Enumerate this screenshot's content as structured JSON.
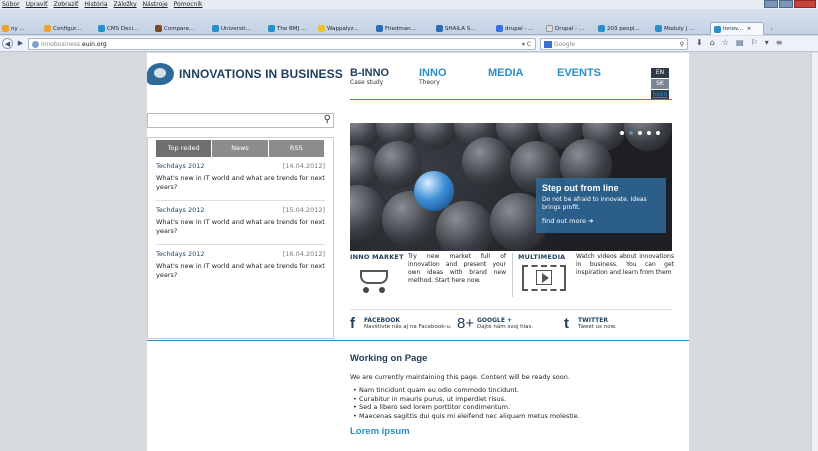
{
  "menu": [
    "Súbor",
    "Upraviť",
    "Zobraziť",
    "História",
    "Záložky",
    "Nástroje",
    "Pomocník"
  ],
  "tabs": [
    {
      "label": "ny ...",
      "color": "#e8a433"
    },
    {
      "label": "Configur...",
      "color": "#e8a433"
    },
    {
      "label": "CMS Deci...",
      "color": "#2a8fc6"
    },
    {
      "label": "Compare...",
      "color": "#7b4a1f"
    },
    {
      "label": "Universit...",
      "color": "#2a8fc6"
    },
    {
      "label": "The BMJ ...",
      "color": "#2a8fc6"
    },
    {
      "label": "Wappalyz...",
      "color": "#e8c433"
    },
    {
      "label": "Friedman...",
      "color": "#2a6fb6"
    },
    {
      "label": "SHAILA S...",
      "color": "#2a6fb6"
    },
    {
      "label": "drupal - ...",
      "color": "#3a6fe6"
    },
    {
      "label": "Drupal - ...",
      "color": "#ddd"
    },
    {
      "label": "203 peopl...",
      "color": "#2a8fc6"
    },
    {
      "label": "Moduly | ...",
      "color": "#2a8fc6"
    },
    {
      "label": "Innov...",
      "color": "#2a8fc6"
    }
  ],
  "browser": {
    "url_prefix": "innobusiness.",
    "url_domain": "euin.org",
    "search_placeholder": "Google"
  },
  "site": {
    "logo_text": "INNOVATIONS IN BUSINESS",
    "nav": [
      {
        "title": "B-INNO",
        "sub": "Case study"
      },
      {
        "title": "INNO",
        "sub": "Theory"
      },
      {
        "title": "MEDIA",
        "sub": ""
      },
      {
        "title": "EVENTS",
        "sub": ""
      }
    ],
    "lang": [
      "EN",
      "SK"
    ],
    "login": "login"
  },
  "sidebar": {
    "tabs": [
      "Top reded",
      "News",
      "RSS"
    ],
    "news": [
      {
        "title": "Techdays 2012",
        "date": "[14.04.2012]",
        "body": "What's new in IT world and what are trends for next years?"
      },
      {
        "title": "Techdays 2012",
        "date": "[15.04.2012]",
        "body": "What's new in IT world and what are trends for next years?"
      },
      {
        "title": "Techdays 2012",
        "date": "[16.04.2012]",
        "body": "What's new in IT world and what are trends for next years?"
      }
    ]
  },
  "hero": {
    "heading": "Step out from line",
    "text": "Do not be afraid to innovate. Ideas brings profit.",
    "more": "find out more ➔"
  },
  "blocks": [
    {
      "title": "INNO MARKET",
      "text": "Try new market full of innovation and present your own ideas with brand new method. Start here now."
    },
    {
      "title": "MULTIMEDIA",
      "text": "Watch videos about innovations in business. You can get inspiration and learn from them"
    }
  ],
  "social": [
    {
      "icon": "f",
      "label": "FACEBOOK",
      "sub": "Navštívte nás aj na Facebook-u."
    },
    {
      "icon": "8+",
      "label": "GOOGLE +",
      "sub": "Dajte nám svoj hlas."
    },
    {
      "icon": "t",
      "label": "TWITTER",
      "sub": "Tweet us now."
    }
  ],
  "article": {
    "heading": "Working on Page",
    "intro": "We are currently maintaining this page. Content will be ready soon.",
    "items": [
      "Nam tincidunt quam eu odio commodo tincidunt.",
      "Curabitur in mauris purus, ut imperdiet risus.",
      "Sed a libero sed lorem porttitor condimentum.",
      "Maecenas sagittis dui quis mi eleifend nec aliquam metus molestie."
    ],
    "subheading": "Lorem ipsum"
  }
}
